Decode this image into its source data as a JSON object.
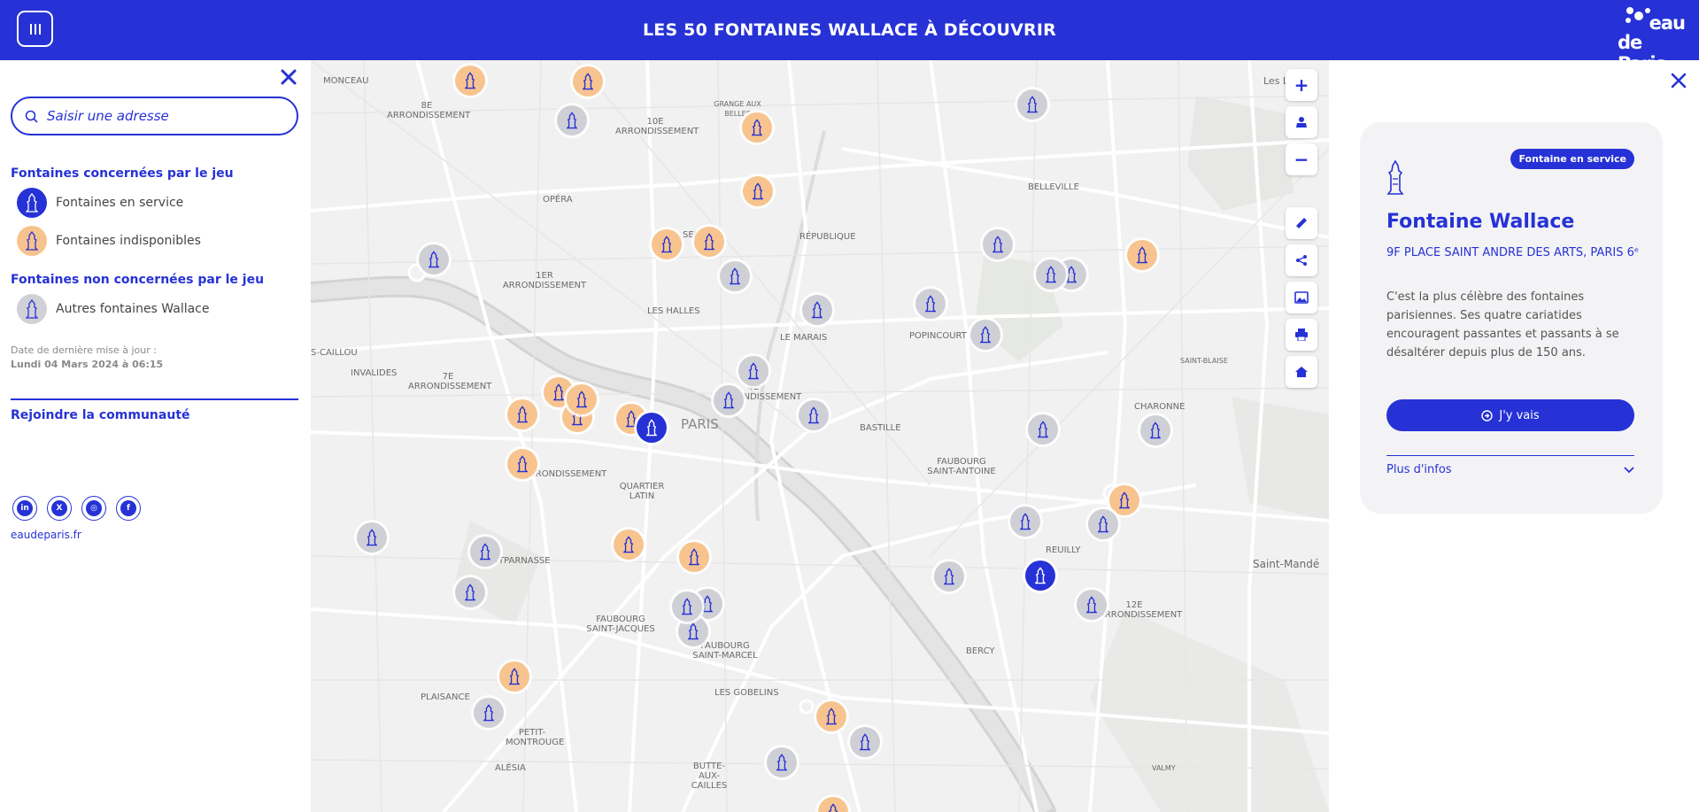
{
  "header": {
    "title": "LES 50 FONTAINES WALLACE À DÉCOUVRIR",
    "logo_line1": "eau",
    "logo_line2": "de Paris"
  },
  "left_panel": {
    "search_placeholder": "Saisir une adresse",
    "section_game": "Fontaines concernées par le jeu",
    "legend_in_service": "Fontaines en service",
    "legend_unavailable": "Fontaines indisponibles",
    "section_not_game": "Fontaines non concernées par le jeu",
    "legend_other": "Autres fontaines Wallace",
    "date_label": "Date de dernière mise à jour :",
    "date_value": "Lundi 04 Mars 2024 à 06:15",
    "community_title": "Rejoindre la communauté",
    "socials": [
      {
        "name": "linkedin",
        "glyph": "in"
      },
      {
        "name": "x",
        "glyph": "X"
      },
      {
        "name": "instagram",
        "glyph": "◎"
      },
      {
        "name": "facebook",
        "glyph": "f"
      }
    ],
    "site_link": "eaudeparis.fr"
  },
  "map": {
    "labels": {
      "monceau": "MONCEAU",
      "arr8": "8E ARRONDISSEMENT",
      "arr10": "10E ARRONDISSEMENT",
      "grange": "GRANGE AUX BELLES",
      "belleville": "BELLEVILLE",
      "opera": "OPÉRA",
      "sentier": "SENTIER",
      "republique": "RÉPUBLIQUE",
      "arr1": "1ER ARRONDISSEMENT",
      "halles": "LES HALLES",
      "marais": "LE MARAIS",
      "popincourt": "POPINCOURT",
      "invalides": "INVALIDES",
      "arr7": "7E ARRONDISSEMENT",
      "caillou": "S-CAILLOU",
      "arr4": "4E ARRONDISSEMENT",
      "paris": "PARIS",
      "arr6": "ARRONDISSEMENT",
      "quartier_latin": "QUARTIER LATIN",
      "faubourg_st_antoine": "FAUBOURG SAINT-ANTOINE",
      "charonne": "CHARONNE",
      "montparnasse": "MONTPARNASSE",
      "reuilly": "REUILLY",
      "saint_mande": "Saint-Mandé",
      "arr12": "12E ARRONDISSEMENT",
      "faubourg_st_jacques": "FAUBOURG SAINT-JACQUES",
      "faubourg_st_marcel": "FAUBOURG SAINT-MARCEL",
      "bercy": "BERCY",
      "gobelins": "LES GOBELINS",
      "plaisance": "PLAISANCE",
      "petit_montrouge": "PETIT-MONTROUGE",
      "alesia": "ALÉSIA",
      "butte": "BUTTE-AUX-CAILLES",
      "valmy": "VALMY",
      "bastille": "BASTILLE",
      "saint_blaise": "SAINT-BLAISE",
      "les_lilas": "Les L"
    }
  },
  "right_panel": {
    "badge": "Fontaine en service",
    "title": "Fontaine Wallace",
    "address": "9F PLACE SAINT ANDRE DES ARTS, PARIS 6ᵉ",
    "description": "C'est la plus célèbre des fontaines parisiennes. Ses quatre cariatides encouragent passantes et passants à se désaltérer depuis plus de 150 ans.",
    "go_button": "J'y vais",
    "more_info": "Plus d'infos"
  },
  "colors": {
    "brand": "#2632d6",
    "unavailable": "#f7c48f",
    "other": "#cfcfd6"
  }
}
